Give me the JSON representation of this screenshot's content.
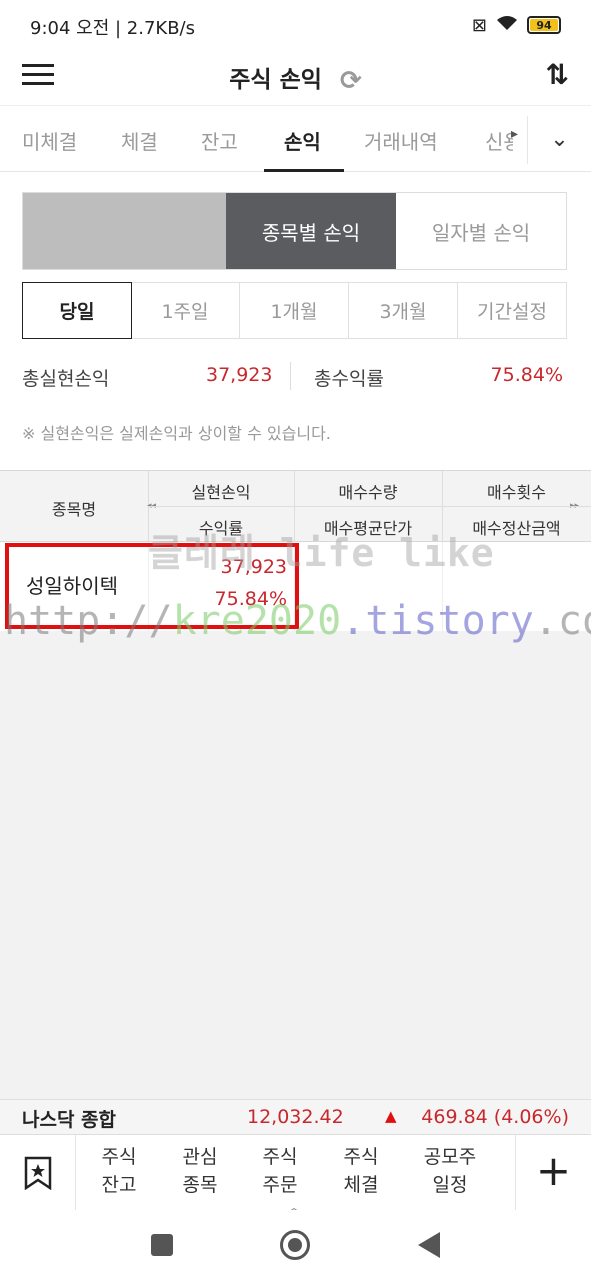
{
  "status_bar": {
    "time": "9:04 오전 | 2.7KB/s",
    "battery": "94"
  },
  "header": {
    "title": "주식 손익"
  },
  "tabs": [
    {
      "label": "미체결"
    },
    {
      "label": "체결"
    },
    {
      "label": "잔고"
    },
    {
      "label": "손익"
    },
    {
      "label": "거래내역"
    },
    {
      "label": "신용"
    }
  ],
  "view_toggle": {
    "by_stock": "종목별 손익",
    "by_date": "일자별 손익"
  },
  "periods": [
    "당일",
    "1주일",
    "1개월",
    "3개월",
    "기간설정"
  ],
  "summary": {
    "realized_label": "총실현손익",
    "realized_value": "37,923",
    "rate_label": "총수익률",
    "rate_value": "75.84%"
  },
  "note": "※ 실현손익은 실제손익과 상이할 수 있습니다.",
  "table": {
    "headers": {
      "name": "종목명",
      "realized": "실현손익",
      "rate": "수익률",
      "buy_qty": "매수수량",
      "buy_avg": "매수평균단가",
      "buy_count": "매수횟수",
      "buy_amount": "매수정산금액"
    },
    "rows": [
      {
        "name": "성일하이텍",
        "realized": "37,923",
        "rate": "75.84%"
      }
    ]
  },
  "watermark": {
    "line1": "클레레 life like",
    "url_a": "http://",
    "url_b": "kre2020",
    "url_c": ".tistory",
    "url_d": ".com"
  },
  "ticker": {
    "name": "나스닥 종합",
    "value": "12,032.42",
    "change": "469.84 (4.06%)"
  },
  "bottom_nav": [
    {
      "line1": "주식",
      "line2": "잔고"
    },
    {
      "line1": "관심",
      "line2": "종목"
    },
    {
      "line1": "주식",
      "line2": "주문"
    },
    {
      "line1": "주식",
      "line2": "체결"
    },
    {
      "line1": "공모주",
      "line2": "일정"
    }
  ],
  "colors": {
    "positive": "#c8282d",
    "active_segment": "#5a5c5f",
    "highlight_box": "#e01010"
  }
}
